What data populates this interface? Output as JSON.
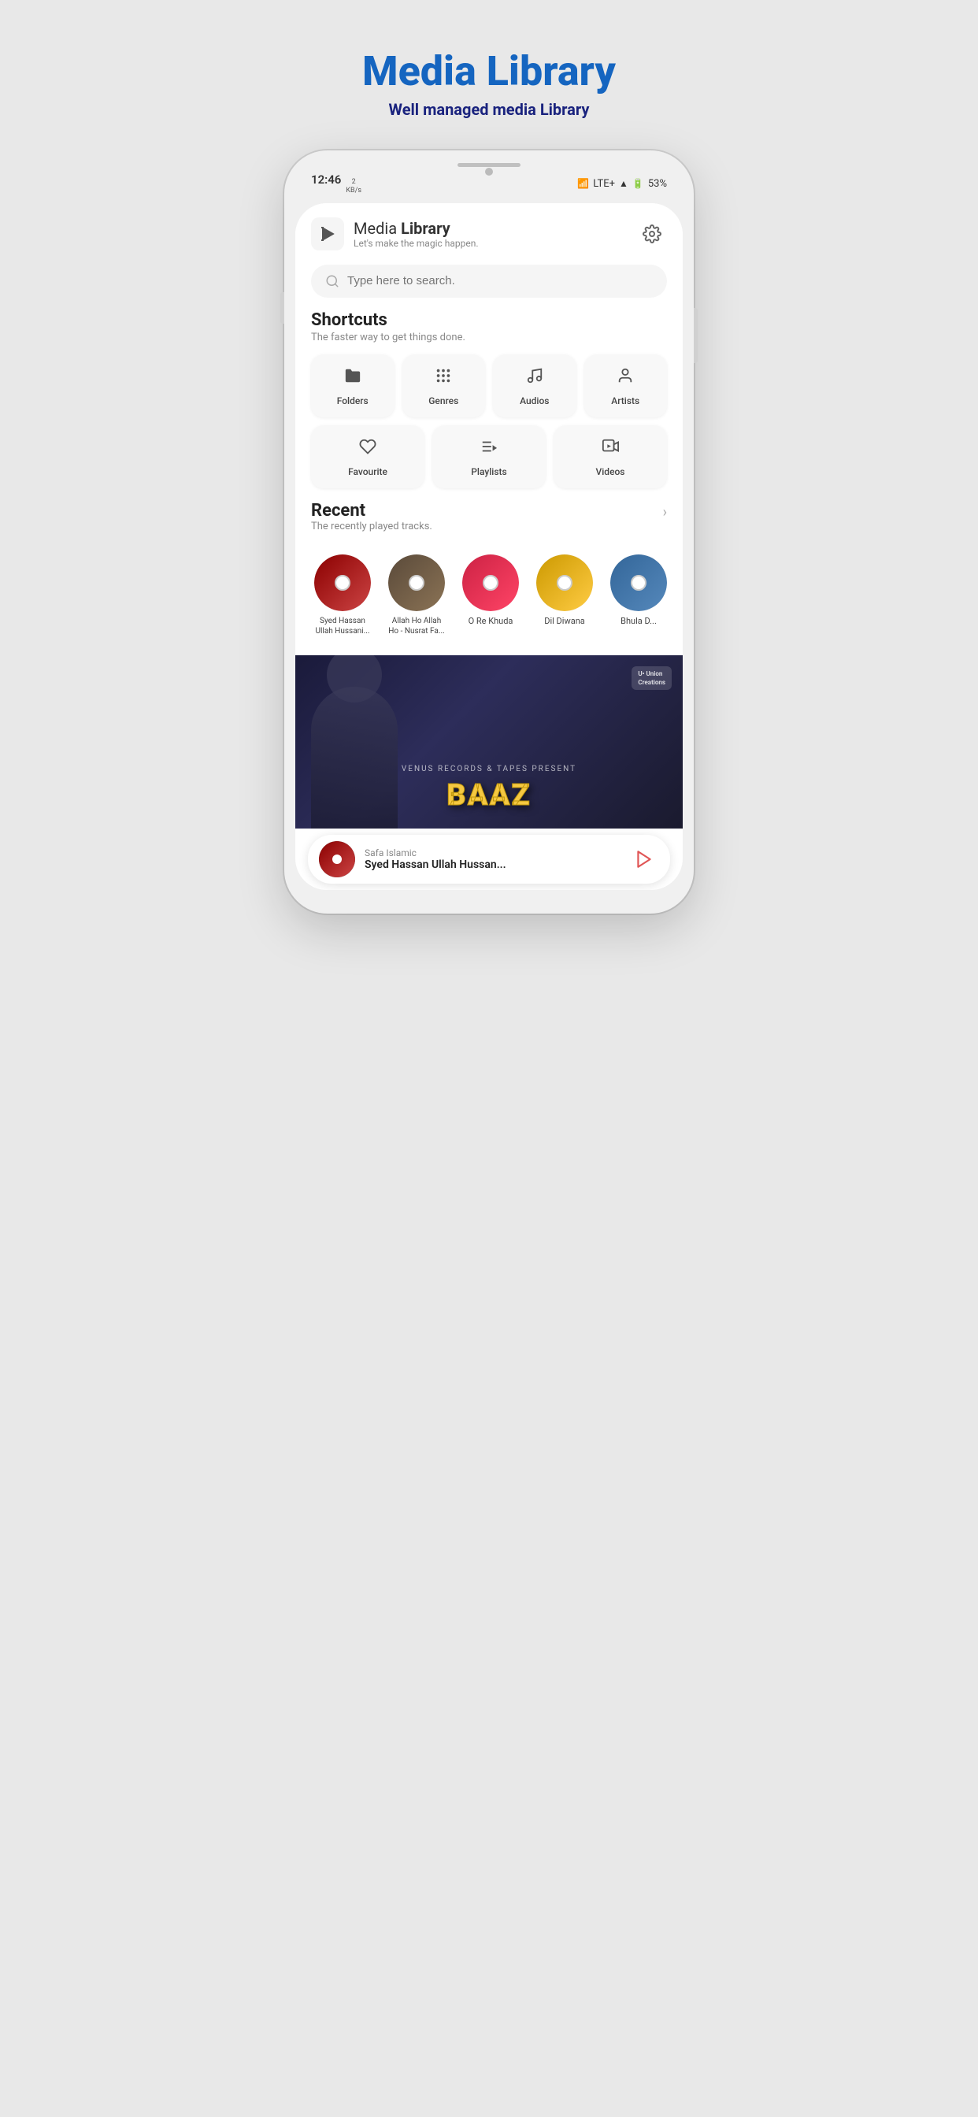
{
  "hero": {
    "title": "Media Library",
    "subtitle": "Well managed media Library"
  },
  "status_bar": {
    "time": "12:46",
    "data_speed": "2\nKB/s",
    "wifi_icon": "wifi",
    "lte_label": "LTE+",
    "signal_icon": "signal",
    "battery": "53%"
  },
  "app_header": {
    "title_normal": "Media ",
    "title_bold": "Library",
    "subtitle": "Let's make the magic happen.",
    "settings_label": "Settings"
  },
  "search": {
    "placeholder": "Type here to search."
  },
  "shortcuts": {
    "title": "Shortcuts",
    "subtitle": "The faster way to get things done.",
    "items_row1": [
      {
        "id": "folders",
        "label": "Folders",
        "icon": "📁"
      },
      {
        "id": "genres",
        "label": "Genres",
        "icon": "⠿"
      },
      {
        "id": "audios",
        "label": "Audios",
        "icon": "📊"
      },
      {
        "id": "artists",
        "label": "Artists",
        "icon": "👤"
      }
    ],
    "items_row2": [
      {
        "id": "favourite",
        "label": "Favourite",
        "icon": "♡"
      },
      {
        "id": "playlists",
        "label": "Playlists",
        "icon": "≡▶"
      },
      {
        "id": "videos",
        "label": "Videos",
        "icon": "▶□"
      }
    ]
  },
  "recent": {
    "title": "Recent",
    "subtitle": "The recently played tracks.",
    "tracks": [
      {
        "id": 1,
        "name": "Syed Hassan Ullah Hussani...",
        "color": "track1"
      },
      {
        "id": 2,
        "name": "Allah Ho Allah Ho - Nusrat Fa...",
        "color": "track2"
      },
      {
        "id": 3,
        "name": "O Re Khuda",
        "color": "track3"
      },
      {
        "id": 4,
        "name": "Dil Diwana",
        "color": "track4"
      },
      {
        "id": 5,
        "name": "Bhula D...",
        "color": "track5"
      }
    ]
  },
  "album_banner": {
    "record_label": "VENUS RECORDS &\nTAPES PRESENT",
    "album_name": "BAAZ",
    "logo_corner": "U• Union\nCreations"
  },
  "now_playing": {
    "artist": "Safa Islamic",
    "track": "Syed Hassan Ullah Hussan..."
  }
}
